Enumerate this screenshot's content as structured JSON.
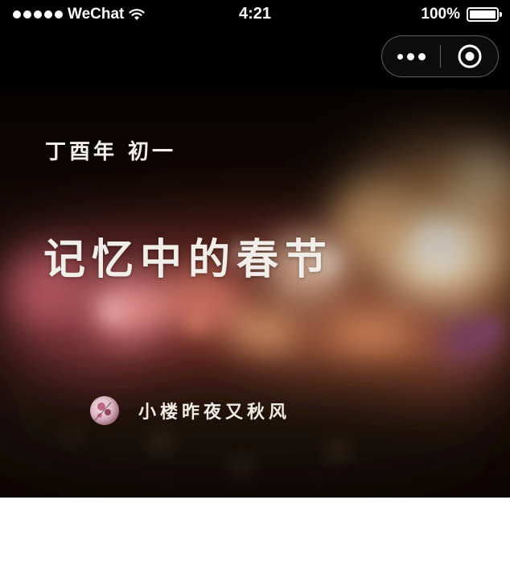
{
  "status_bar": {
    "carrier": "WeChat",
    "time": "4:21",
    "battery_percent": "100%",
    "signal_dots": 5,
    "battery_level": 1.0
  },
  "nav_bar": {
    "more_icon": "more-dots-icon",
    "close_icon": "target-close-icon"
  },
  "hero": {
    "tag": "丁酉年 初一",
    "title": "记忆中的春节",
    "author_name": "小楼昨夜又秋风"
  },
  "colors": {
    "status_bg": "#000000",
    "page_bg": "#ffffff",
    "text_light": "#f1ede8"
  }
}
